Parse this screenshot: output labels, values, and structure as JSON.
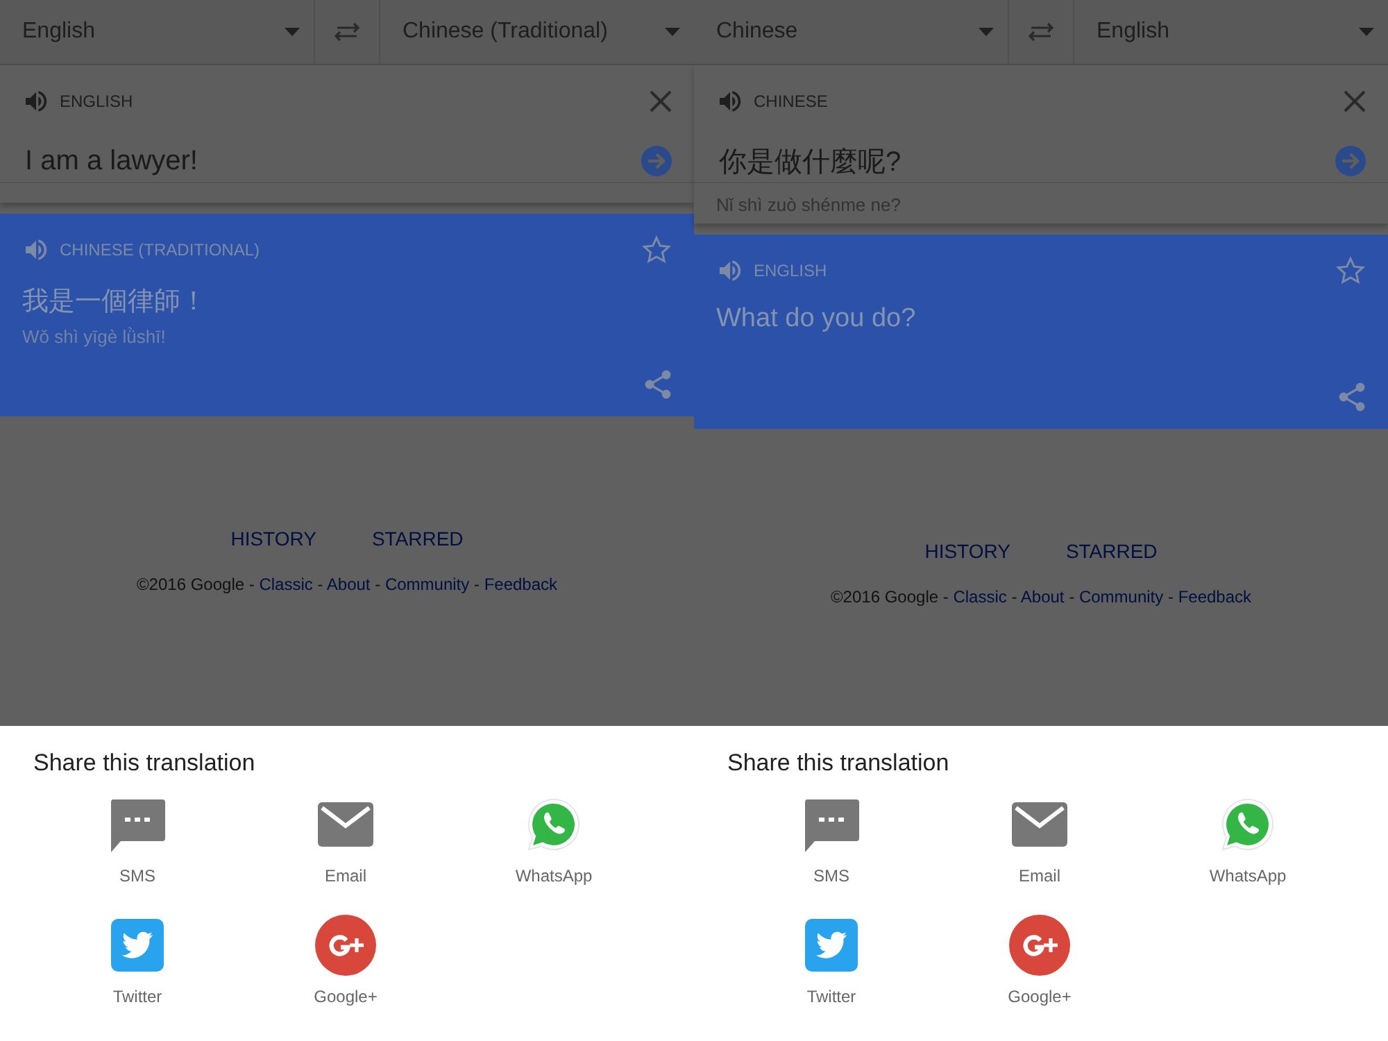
{
  "panels": [
    {
      "source_language": "English",
      "target_language": "Chinese (Traditional)",
      "input": {
        "label": "ENGLISH",
        "text": "I am a lawyer!"
      },
      "result": {
        "label": "CHINESE (TRADITIONAL)",
        "text": "我是一個律師！",
        "romanization": "Wǒ shì yīgè lǜshī!"
      },
      "nav": [
        "HISTORY",
        "STARRED"
      ],
      "footer": [
        {
          "kind": "text",
          "text": "©2016 Google -"
        },
        {
          "kind": "link",
          "text": "Classic"
        },
        {
          "kind": "text",
          "text": "-"
        },
        {
          "kind": "link",
          "text": "About"
        },
        {
          "kind": "text",
          "text": "-"
        },
        {
          "kind": "link",
          "text": "Community"
        },
        {
          "kind": "text",
          "text": "-"
        },
        {
          "kind": "link",
          "text": "Feedback"
        }
      ],
      "share": {
        "title": "Share this translation",
        "targets": [
          {
            "kind": "sms",
            "label": "SMS"
          },
          {
            "kind": "email",
            "label": "Email"
          },
          {
            "kind": "whatsapp",
            "label": "WhatsApp"
          },
          {
            "kind": "twitter",
            "label": "Twitter"
          },
          {
            "kind": "googleplus",
            "label": "Google+"
          }
        ]
      }
    },
    {
      "source_language": "Chinese",
      "target_language": "English",
      "input": {
        "label": "CHINESE",
        "text": "你是做什麼呢?",
        "romanization": "Nǐ shì zuò shénme ne?"
      },
      "result": {
        "label": "ENGLISH",
        "text": "What do you do?"
      },
      "nav": [
        "HISTORY",
        "STARRED"
      ],
      "footer": [
        {
          "kind": "text",
          "text": "©2016 Google -"
        },
        {
          "kind": "link",
          "text": "Classic"
        },
        {
          "kind": "text",
          "text": "-"
        },
        {
          "kind": "link",
          "text": "About"
        },
        {
          "kind": "text",
          "text": "-"
        },
        {
          "kind": "link",
          "text": "Community"
        },
        {
          "kind": "text",
          "text": "-"
        },
        {
          "kind": "link",
          "text": "Feedback"
        }
      ],
      "share": {
        "title": "Share this translation",
        "targets": [
          {
            "kind": "sms",
            "label": "SMS"
          },
          {
            "kind": "email",
            "label": "Email"
          },
          {
            "kind": "whatsapp",
            "label": "WhatsApp"
          },
          {
            "kind": "twitter",
            "label": "Twitter"
          },
          {
            "kind": "googleplus",
            "label": "Google+"
          }
        ]
      }
    }
  ]
}
